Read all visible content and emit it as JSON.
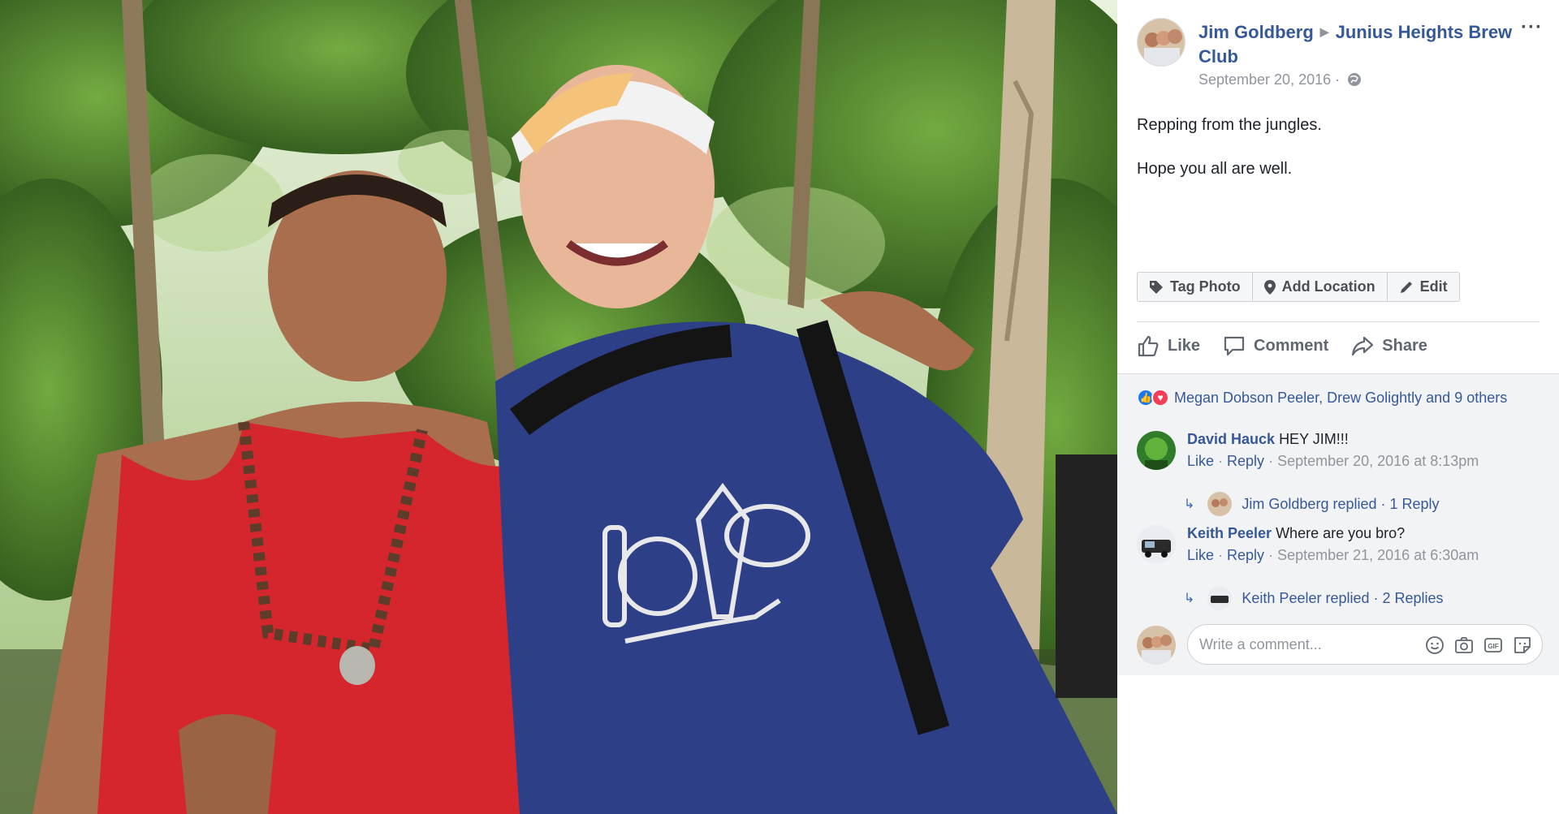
{
  "post": {
    "author": "Jim Goldberg",
    "group": "Junius Heights Brew Club",
    "date": "September 20, 2016 ·",
    "more_label": "···",
    "lines": [
      "Repping from the jungles.",
      "Hope you all are well."
    ]
  },
  "photo_tools": {
    "tag": "Tag Photo",
    "location": "Add Location",
    "edit": "Edit"
  },
  "actions": {
    "like": "Like",
    "comment": "Comment",
    "share": "Share"
  },
  "reactions": {
    "summary": "Megan Dobson Peeler, Drew Golightly and 9 others"
  },
  "comments": [
    {
      "author": "David Hauck",
      "text": "HEY JIM!!!",
      "like": "Like",
      "reply": "Reply",
      "time": "· September 20, 2016 at 8:13pm",
      "replies": "Jim Goldberg replied · 1 Reply"
    },
    {
      "author": "Keith Peeler",
      "text": "Where are you bro?",
      "like": "Like",
      "reply": "Reply",
      "time": "· September 21, 2016 at 6:30am",
      "replies": "Keith Peeler replied · 2 Replies"
    }
  ],
  "composer": {
    "placeholder": "Write a comment..."
  },
  "colors": {
    "link": "#365899",
    "muted": "#90949c",
    "panel_bg": "#f2f3f5"
  },
  "icons": [
    "tag-icon",
    "location-pin-icon",
    "pencil-icon",
    "thumbs-up-icon",
    "speech-bubble-icon",
    "share-arrow-icon",
    "globe-icon",
    "smiley-icon",
    "camera-icon",
    "gif-icon",
    "sticker-icon"
  ]
}
